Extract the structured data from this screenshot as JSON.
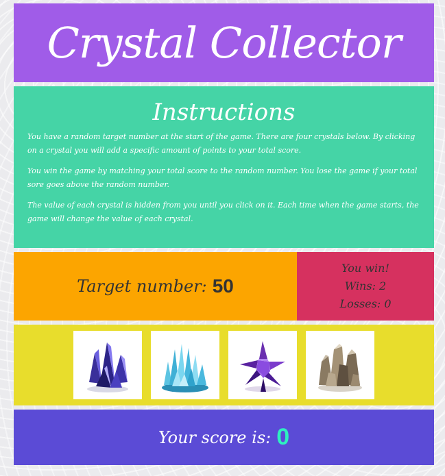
{
  "colors": {
    "header": "#a05ce8",
    "instructions": "#45d4a6",
    "target": "#fca500",
    "record": "#d6315f",
    "crystals": "#e8dd2c",
    "score": "#5b4bd6",
    "score_number": "#2ef0c0"
  },
  "header": {
    "title": "Crystal Collector"
  },
  "instructions": {
    "heading": "Instructions",
    "paragraphs": [
      "You have a random target number at the start of the game. There are four crystals below. By clicking on a crystal you will add a specific amount of points to your total score.",
      "You win the game by matching your total score to the random number. You lose the game if your total sore goes above the random number.",
      "The value of each crystal is hidden from you until you click on it. Each time when the game starts, the game will change the value of each crystal."
    ]
  },
  "target": {
    "label": "Target number:",
    "value": "50"
  },
  "record": {
    "message": "You win!",
    "wins": "Wins: 2",
    "losses": "Losses: 0"
  },
  "crystals": [
    {
      "icon": "blue-violet-crystal-icon"
    },
    {
      "icon": "light-blue-crystal-icon"
    },
    {
      "icon": "purple-crystal-icon"
    },
    {
      "icon": "smoky-quartz-crystal-icon"
    }
  ],
  "score": {
    "label": "Your score is:",
    "value": "0"
  }
}
